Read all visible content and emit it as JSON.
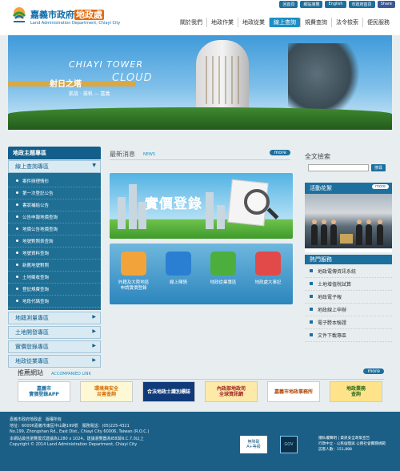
{
  "header": {
    "title_main": "嘉義市政府",
    "title_accent": "地政處",
    "title_en": "Land Administration Department, Chiayi City",
    "util": [
      "回首頁",
      "網站導覽",
      "English",
      "市政府首頁",
      "Share"
    ],
    "nav": [
      "關於我們",
      "地政作業",
      "地政從業",
      "線上查詢",
      "規費查詢",
      "法令檢索",
      "便民服務"
    ],
    "nav_active": 3
  },
  "banner": {
    "line1": "CHIAYI TOWER",
    "line2": "射日之塔",
    "line3": "CLOUD",
    "line4": "凱旋 · 揚帆 — 嘉義"
  },
  "sidebar": {
    "heading": "地政主題專區",
    "sub_heading": "線上查詢專區",
    "items": [
      "案件辦理情形",
      "第一次登記公告",
      "書狀補給公告",
      "公告申報地價查詢",
      "地價公告地價查詢",
      "地號對照表查詢",
      "地號資料查詢",
      "新舊地號對照",
      "土地徵收查詢",
      "登記規費查詢",
      "地段代碼查詢"
    ],
    "footer_items": [
      "地籍測量專區",
      "土地開發專區",
      "實價登錄專區",
      "地政從業專區"
    ]
  },
  "news": {
    "title": "最新消息",
    "title_en": "NEWS",
    "more": "more",
    "promo_label": "實價登錄"
  },
  "icons": [
    {
      "label": "外籍及大陸地區\n申請實價登錄"
    },
    {
      "label": "線上陳情"
    },
    {
      "label": "地政從業專區"
    },
    {
      "label": "地政處大事記"
    }
  ],
  "search": {
    "title": "全文檢索",
    "placeholder": "",
    "button": "搜尋"
  },
  "activity": {
    "title": "活動花絮",
    "more": "more"
  },
  "services": {
    "title": "熱門服務",
    "items": [
      "地政電傳資訊系統",
      "土地增值稅試算",
      "地政電子報",
      "地政線上申辦",
      "電子謄本驗證",
      "文件下載專區"
    ]
  },
  "links": {
    "title": "推薦網站",
    "title_en": "ACCOMPANIED LINK",
    "more": "more",
    "items": [
      "嘉義市\n實價登錄APP",
      "環境與安全\n災害查詢",
      "合法地政士識別標誌",
      "內政部地政司\n全球資訊網",
      "嘉義市地政事務所",
      "地政業務\n查詢"
    ]
  },
  "footer": {
    "org": "嘉義市政府地政處　版權所有",
    "address": "地址：60006嘉義市東區中山路199號　服務電話：(05)225-4321",
    "address_en": "No.199, Zhongshan Rd., East Dist., Chiayi City 60006, Taiwan (R.O.C.)",
    "note": "本網站最佳瀏覽模式建議為1280 x 1024，建議瀏覽器為IE8與N.C.7.0以上",
    "copyright": "Copyright © 2014 Land Administration Department, Chiayi City",
    "badge1": "無障礙\nA+等級",
    "badge2": "GOV",
    "right_lines": [
      "隱私權聲明 | 資訊安全政策宣告",
      "行政中立 · 公民倫理與 公務社會實踐規範",
      "訪客人數：151,888"
    ]
  },
  "colors": {
    "primary": "#1d6f9e",
    "accent": "#e46a0a",
    "footer": "#1c5f86"
  }
}
